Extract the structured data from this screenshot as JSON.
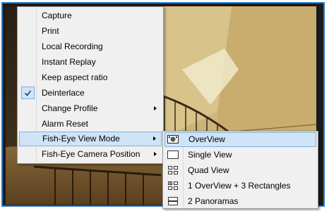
{
  "main_menu": {
    "items": [
      {
        "label": "Capture"
      },
      {
        "label": "Print"
      },
      {
        "label": "Local Recording"
      },
      {
        "label": "Instant Replay"
      },
      {
        "label": "Keep aspect ratio"
      },
      {
        "label": "Deinterlace",
        "checked": true
      },
      {
        "label": "Change Profile",
        "submenu": true
      },
      {
        "label": "Alarm Reset"
      },
      {
        "label": "Fish-Eye View Mode",
        "submenu": true,
        "highlighted": true
      },
      {
        "label": "Fish-Eye Camera Position",
        "submenu": true
      }
    ]
  },
  "sub_menu": {
    "items": [
      {
        "label": "OverView",
        "icon": "overview-icon",
        "highlighted": true
      },
      {
        "label": "Single View",
        "icon": "single-view-icon"
      },
      {
        "label": "Quad View",
        "icon": "quad-view-icon"
      },
      {
        "label": "1 OverView + 3 Rectangles",
        "icon": "overview-plus-rectangles-icon"
      },
      {
        "label": "2 Panoramas",
        "icon": "panoramas-icon"
      }
    ]
  },
  "colors": {
    "highlight_bg": "#cfe4f7",
    "highlight_border": "#7fb1de",
    "frame_border": "#2b79c2",
    "menu_bg": "#f0f0f0"
  }
}
